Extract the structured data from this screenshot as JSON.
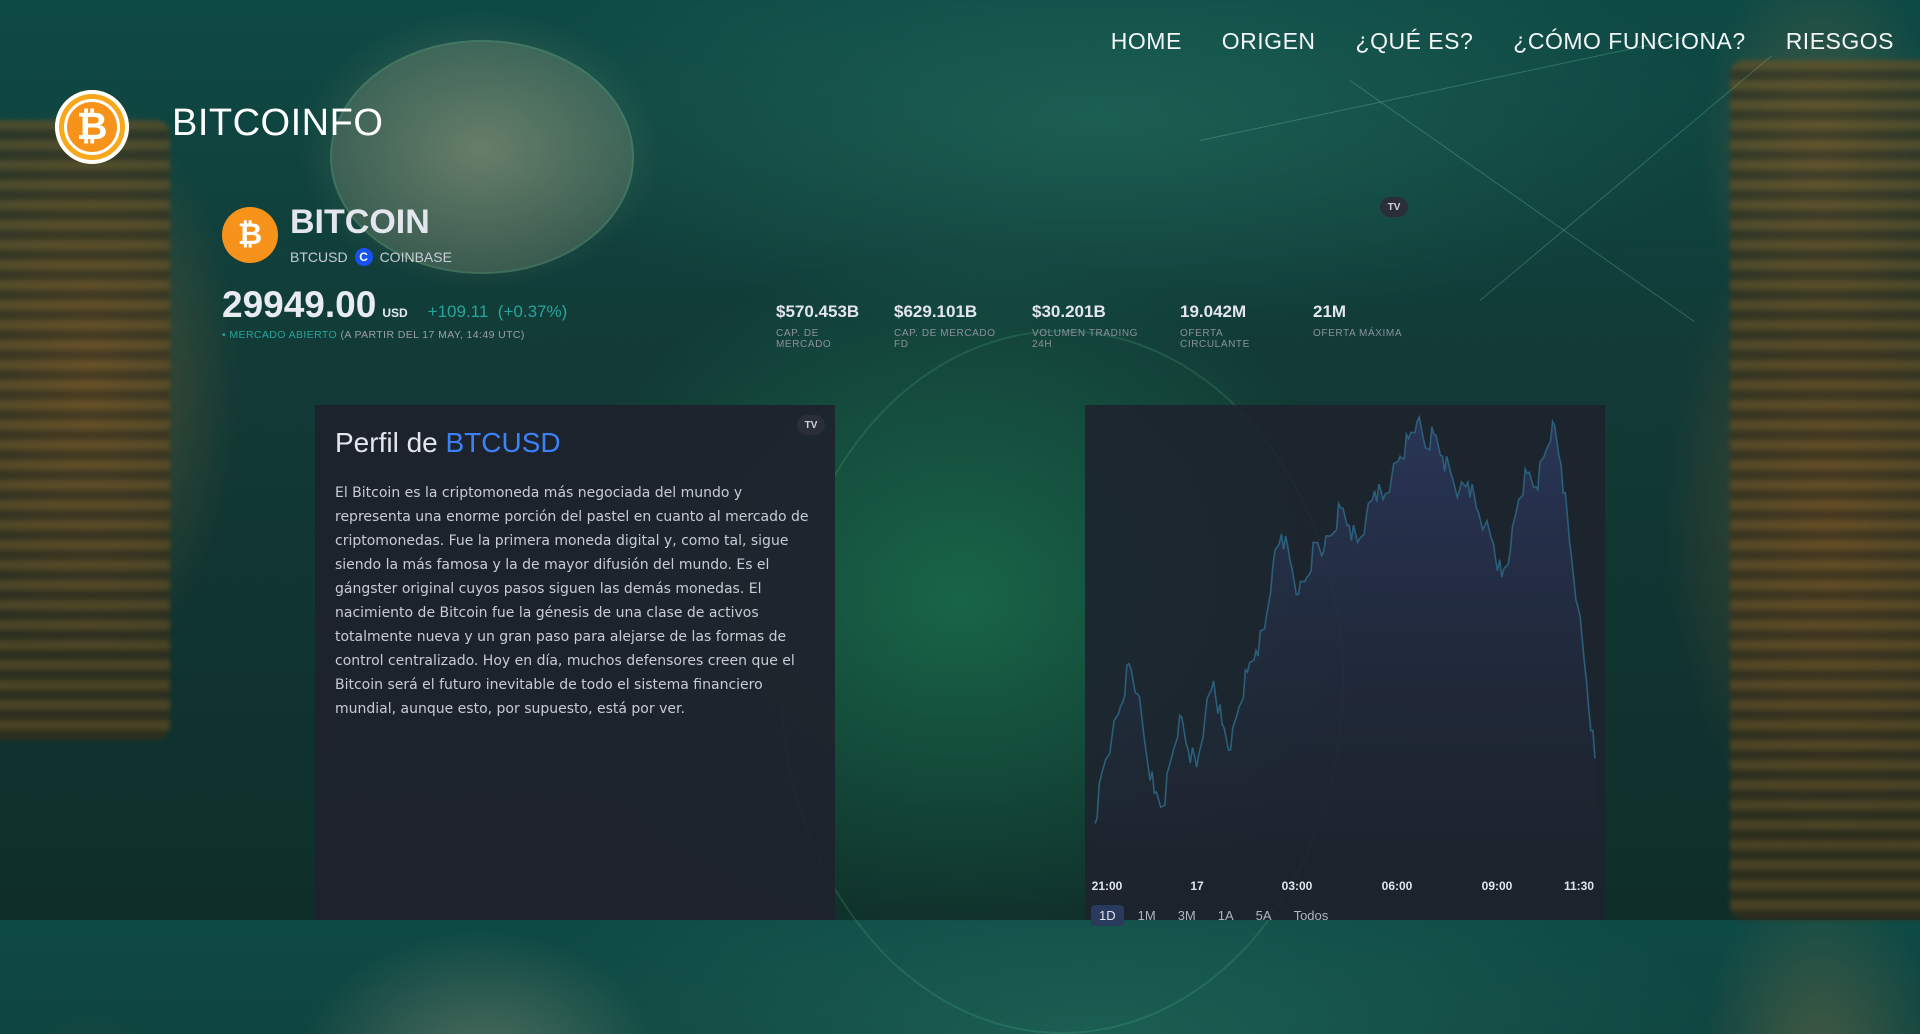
{
  "nav": {
    "items": [
      "HOME",
      "ORIGEN",
      "¿QUÉ ES?",
      "¿CÓMO FUNCIONA?",
      "RIESGOS"
    ]
  },
  "brand": {
    "title": "BITCOINFO",
    "logo_icon": "bitcoin-icon"
  },
  "ticker": {
    "name": "BITCOIN",
    "symbol": "BTCUSD",
    "exchange": "COINBASE",
    "price": "29949.00",
    "currency": "USD",
    "change": "+109.11",
    "change_pct": "(+0.37%)",
    "market_status": "• MERCADO ABIERTO",
    "market_time": "(A PARTIR DEL 17 MAY, 14:49 UTC)",
    "badge": "TV",
    "stats": [
      {
        "value": "$570.453B",
        "label": "CAP. DE MERCADO"
      },
      {
        "value": "$629.101B",
        "label": "CAP. DE MERCADO FD"
      },
      {
        "value": "$30.201B",
        "label": "VOLUMEN TRADING 24H"
      },
      {
        "value": "19.042M",
        "label": "OFERTA CIRCULANTE"
      },
      {
        "value": "21M",
        "label": "OFERTA MÁXIMA"
      }
    ]
  },
  "profile": {
    "title_prefix": "Perfil de ",
    "title_symbol": "BTCUSD",
    "badge": "TV",
    "text": "El Bitcoin es la criptomoneda más negociada del mundo y representa una enorme porción del pastel en cuanto al mercado de criptomonedas. Fue la primera moneda digital y, como tal, sigue siendo la más famosa y la de mayor difusión del mundo. Es el gángster original cuyos pasos siguen las demás monedas. El nacimiento de Bitcoin fue la génesis de una clase de activos totalmente nueva y un gran paso para alejarse de las formas de control centralizado. Hoy en día, muchos defensores creen que el Bitcoin será el futuro inevitable de todo el sistema financiero mundial, aunque esto, por supuesto, está por ver."
  },
  "chart_data": {
    "type": "area",
    "title": "",
    "xlabel": "",
    "ylabel": "",
    "x_ticks": [
      "21:00",
      "17",
      "03:00",
      "06:00",
      "09:00",
      "11:30"
    ],
    "y_relative": [
      0.05,
      0.18,
      0.25,
      0.32,
      0.42,
      0.35,
      0.22,
      0.12,
      0.09,
      0.2,
      0.3,
      0.22,
      0.18,
      0.3,
      0.38,
      0.28,
      0.22,
      0.32,
      0.4,
      0.45,
      0.5,
      0.65,
      0.72,
      0.66,
      0.58,
      0.62,
      0.7,
      0.68,
      0.72,
      0.78,
      0.74,
      0.7,
      0.76,
      0.82,
      0.8,
      0.85,
      0.9,
      0.94,
      0.98,
      0.92,
      0.95,
      0.9,
      0.86,
      0.82,
      0.84,
      0.78,
      0.74,
      0.7,
      0.62,
      0.68,
      0.8,
      0.86,
      0.83,
      0.9,
      0.98,
      0.88,
      0.7,
      0.55,
      0.38,
      0.2
    ],
    "ranges": [
      "1D",
      "1M",
      "3M",
      "1A",
      "5A",
      "Todos"
    ],
    "active_range": "1D",
    "line_color": "#2b5f7a"
  }
}
